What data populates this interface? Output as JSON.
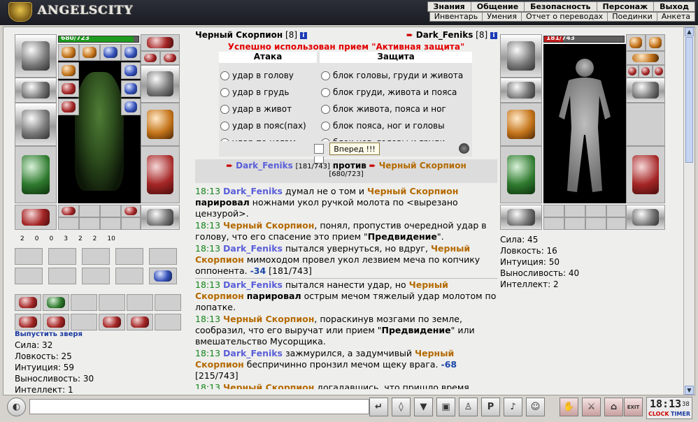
{
  "app": {
    "logo_text": "ANGELSCITY"
  },
  "nav": {
    "top": [
      "Знания",
      "Общение",
      "Безопасность",
      "Персонаж",
      "Выход"
    ],
    "sub": [
      "Инвентарь",
      "Умения",
      "Отчет о переводах",
      "Поединки",
      "Анкета"
    ]
  },
  "left_char": {
    "hp_text": "680/723",
    "hp_fraction": 0.94,
    "counters": [
      "2",
      "0",
      "0",
      "3",
      "2",
      "2",
      "10"
    ],
    "release_pet": "Выпустить зверя",
    "stats": [
      "Сила: 32",
      "Ловкость: 25",
      "Интуиция: 59",
      "Выносливость: 30",
      "Интеллект: 1"
    ]
  },
  "right_char": {
    "hp_text": "181/743",
    "hp_fraction": 0.24,
    "stats": [
      "Сила: 45",
      "Ловкость: 16",
      "Интуиция: 50",
      "Выносливость: 40",
      "Интеллект: 2"
    ]
  },
  "battle": {
    "left_name": "Черный Скорпион",
    "left_level": "[8]",
    "right_name": "Dark_Feniks",
    "right_level": "[8]",
    "info_glyph": "i",
    "arrow_glyph": "➨",
    "status": "Успешно использован прием \"Активная защита\"",
    "attack_header": "Атака",
    "defense_header": "Защита",
    "attacks": [
      "удар в голову",
      "удар в грудь",
      "удар в живот",
      "удар в пояс(пах)",
      "удар по ногам"
    ],
    "defenses": [
      "блок головы, груди и живота",
      "блок груди, живота и пояса",
      "блок живота, пояса и ног",
      "блок пояса, ног и головы",
      "блок ног, головы и груди"
    ],
    "forward_button": "Вперед !!!",
    "vs_left_name": "Dark_Feniks",
    "vs_left_hp": "[181/743]",
    "vs_word": "против",
    "vs_right_name": "Черный Скорпион",
    "vs_right_hp": "[680/723]"
  },
  "log": [
    {
      "time": "18:13",
      "who": "Dark_Feniks",
      "pre": " думал не о том и ",
      "opp": "Черный Скорпион",
      "bold": "парировал",
      "post": " ножнами укол ручкой молота по <вырезано цензурой>.",
      "dmg": "",
      "tail": ""
    },
    {
      "time": "18:13",
      "who": "",
      "pre": "",
      "opp": "Черный Скорпион",
      "bold": "",
      "post": ", понял, пропустив очередной удар в голову, что его спасение это прием \"",
      "bold2": "Предвидение",
      "post2": "\".",
      "dmg": "",
      "tail": ""
    },
    {
      "time": "18:13",
      "who": "Dark_Feniks",
      "pre": " пытался увернуться, но вдруг, ",
      "opp": "Черный Скорпион",
      "bold": "",
      "post": " мимоходом провел укол лезвием меча по копчику оппонента. ",
      "dmg": "-34",
      "tail": " [181/743]"
    },
    {
      "time": "18:13",
      "who": "Dark_Feniks",
      "pre": " пытался нанести удар, но ",
      "opp": "Черный Скорпион",
      "bold": "парировал",
      "post": " острым мечом тяжелый удар молотом по лопатке.",
      "dmg": "",
      "tail": ""
    },
    {
      "time": "18:13",
      "who": "",
      "pre": "",
      "opp": "Черный Скорпион",
      "bold": "",
      "post": ", пораскинув мозгами по земле, сообразил, что его выручат или прием \"",
      "bold2": "Предвидение",
      "post2": "\" или вмешательство Мусорщика.",
      "dmg": "",
      "tail": ""
    },
    {
      "time": "18:13",
      "who": "Dark_Feniks",
      "pre": " зажмурился, а задумчивый ",
      "opp": "Черный Скорпион",
      "bold": "",
      "post": " беспричинно пронзил мечом щеку врага. ",
      "dmg": "-68",
      "tail": " [215/743]"
    },
    {
      "time": "18:13",
      "who": "",
      "pre": "",
      "opp": "Черный Скорпион",
      "bold": "",
      "post": " догадавшись, что пришло время",
      "dmg": "",
      "tail": ""
    }
  ],
  "clock": {
    "time": "18:13",
    "seconds": "38",
    "clock_label": "CLOCK",
    "timer_label": "TIMER",
    "exit_label": "EXIT"
  }
}
